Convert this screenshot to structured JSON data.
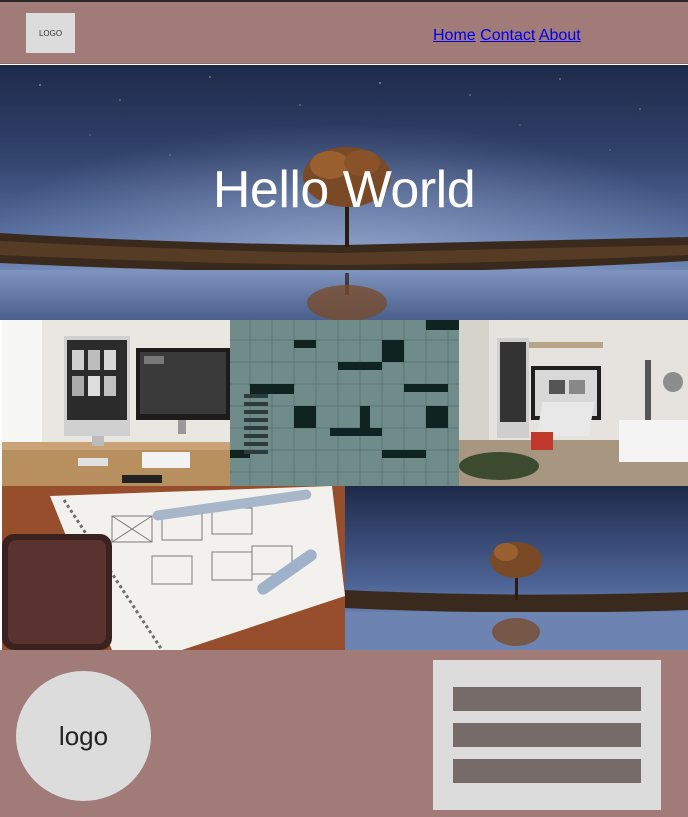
{
  "header": {
    "logo": "LOGO",
    "nav": [
      {
        "label": "Home"
      },
      {
        "label": "Contact"
      },
      {
        "label": "About"
      }
    ]
  },
  "hero": {
    "title": "Hello World"
  },
  "gallery": {
    "images": [
      {
        "icon": "desk-computer-photo"
      },
      {
        "icon": "tiled-building-facade-photo"
      },
      {
        "icon": "office-desk-laptop-photo"
      },
      {
        "icon": "wireframe-sketch-notebook-photo"
      },
      {
        "icon": "tree-reflection-lake-photo"
      }
    ]
  },
  "footer": {
    "logo": "logo",
    "bars": 3
  },
  "colors": {
    "brand": "#a07b78",
    "placeholder": "#dcdcdc",
    "bar": "#776b6a"
  }
}
